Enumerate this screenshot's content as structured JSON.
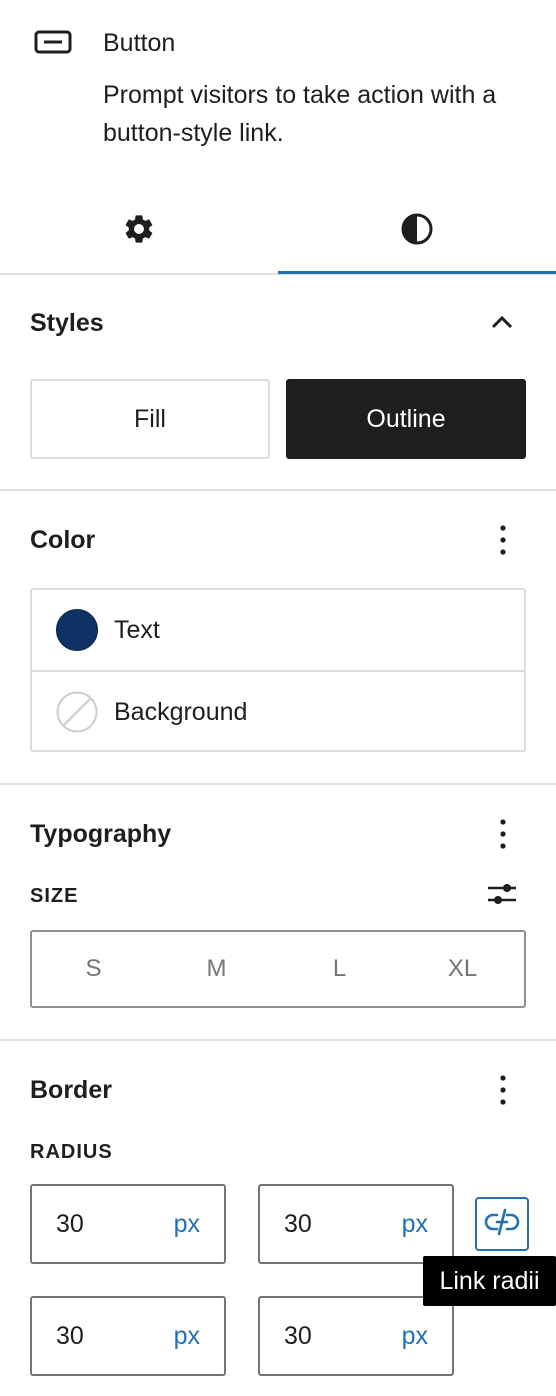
{
  "block": {
    "title": "Button",
    "description": "Prompt visitors to take action with a button-style link.",
    "icon": "button-block-icon"
  },
  "tabs": [
    {
      "name": "settings",
      "icon": "gear-icon",
      "active": false
    },
    {
      "name": "styles",
      "icon": "half-circle-contrast-icon",
      "active": true
    }
  ],
  "styles_panel": {
    "title": "Styles",
    "options": [
      "Fill",
      "Outline"
    ],
    "selected": "Outline"
  },
  "color_panel": {
    "title": "Color",
    "items": [
      {
        "label": "Text",
        "color": "#0f3265"
      },
      {
        "label": "Background",
        "color": "none"
      }
    ]
  },
  "typography_panel": {
    "title": "Typography",
    "size_label": "SIZE",
    "sizes": [
      "S",
      "M",
      "L",
      "XL"
    ]
  },
  "border_panel": {
    "title": "Border",
    "radius_label": "RADIUS",
    "radii": [
      {
        "value": "30",
        "unit": "px"
      },
      {
        "value": "30",
        "unit": "px"
      },
      {
        "value": "30",
        "unit": "px"
      },
      {
        "value": "30",
        "unit": "px"
      }
    ],
    "link_tooltip": "Link radii"
  },
  "colors": {
    "accent": "#2271b1",
    "dark": "#1e1e1e",
    "border": "#dcdcde"
  }
}
